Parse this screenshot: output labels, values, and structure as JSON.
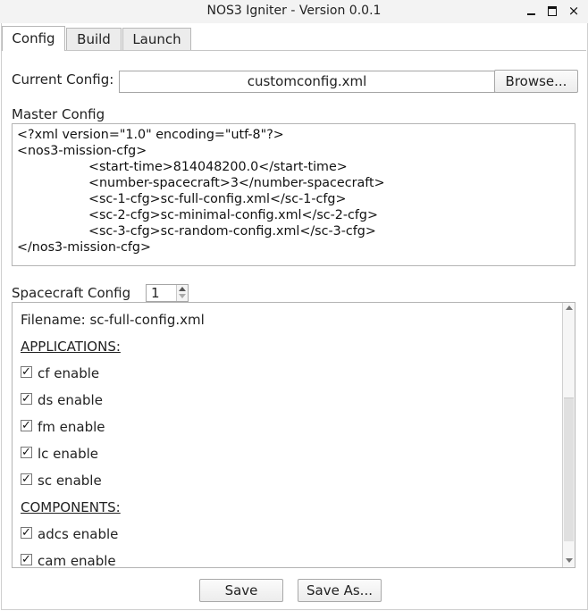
{
  "window": {
    "title": "NOS3 Igniter - Version 0.0.1",
    "controls": {
      "minimize": "minimize-icon",
      "maximize": "maximize-icon",
      "close": "×"
    }
  },
  "tabs": [
    {
      "label": "Config",
      "active": true
    },
    {
      "label": "Build",
      "active": false
    },
    {
      "label": "Launch",
      "active": false
    }
  ],
  "current_config": {
    "label": "Current Config:",
    "value": "customconfig.xml",
    "browse_label": "Browse..."
  },
  "master_config": {
    "label": "Master Config",
    "lines": [
      "<?xml version=\"1.0\" encoding=\"utf-8\"?>",
      "<nos3-mission-cfg>",
      "<start-time>814048200.0</start-time>",
      "<number-spacecraft>3</number-spacecraft>",
      "<sc-1-cfg>sc-full-config.xml</sc-1-cfg>",
      "<sc-2-cfg>sc-minimal-config.xml</sc-2-cfg>",
      "<sc-3-cfg>sc-random-config.xml</sc-3-cfg>",
      "</nos3-mission-cfg>"
    ]
  },
  "spacecraft_config": {
    "label": "Spacecraft Config",
    "spinner_value": "1",
    "filename": "Filename: sc-full-config.xml",
    "applications_header": "APPLICATIONS:",
    "applications": [
      {
        "label": "cf enable",
        "checked": true
      },
      {
        "label": "ds enable",
        "checked": true
      },
      {
        "label": "fm enable",
        "checked": true
      },
      {
        "label": "lc enable",
        "checked": true
      },
      {
        "label": "sc enable",
        "checked": true
      }
    ],
    "components_header": "COMPONENTS:",
    "components": [
      {
        "label": "adcs enable",
        "checked": true
      },
      {
        "label": "cam enable",
        "checked": true
      }
    ],
    "check_mark": "✓"
  },
  "footer": {
    "save_label": "Save",
    "save_as_label": "Save As..."
  }
}
